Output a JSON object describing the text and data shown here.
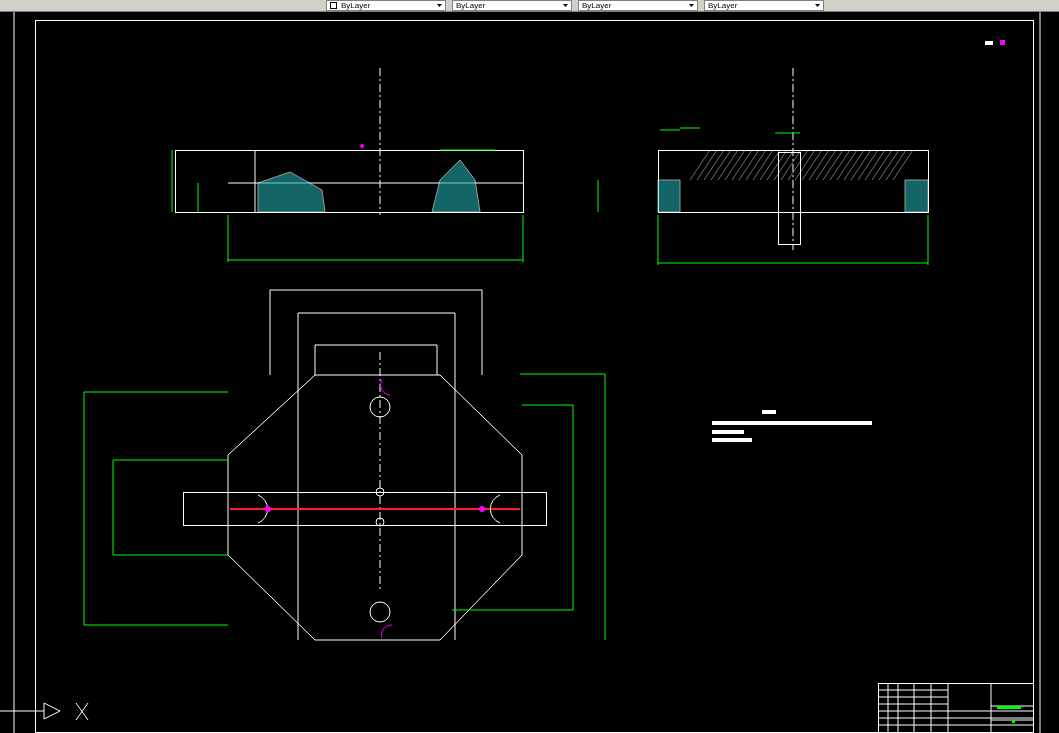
{
  "toolbar": {
    "dropdowns": [
      {
        "text": "ByLayer",
        "kind": "color"
      },
      {
        "text": "ByLayer",
        "kind": "plain"
      },
      {
        "text": "ByLayer",
        "kind": "plain"
      },
      {
        "text": "ByLayer",
        "kind": "plain"
      }
    ]
  }
}
